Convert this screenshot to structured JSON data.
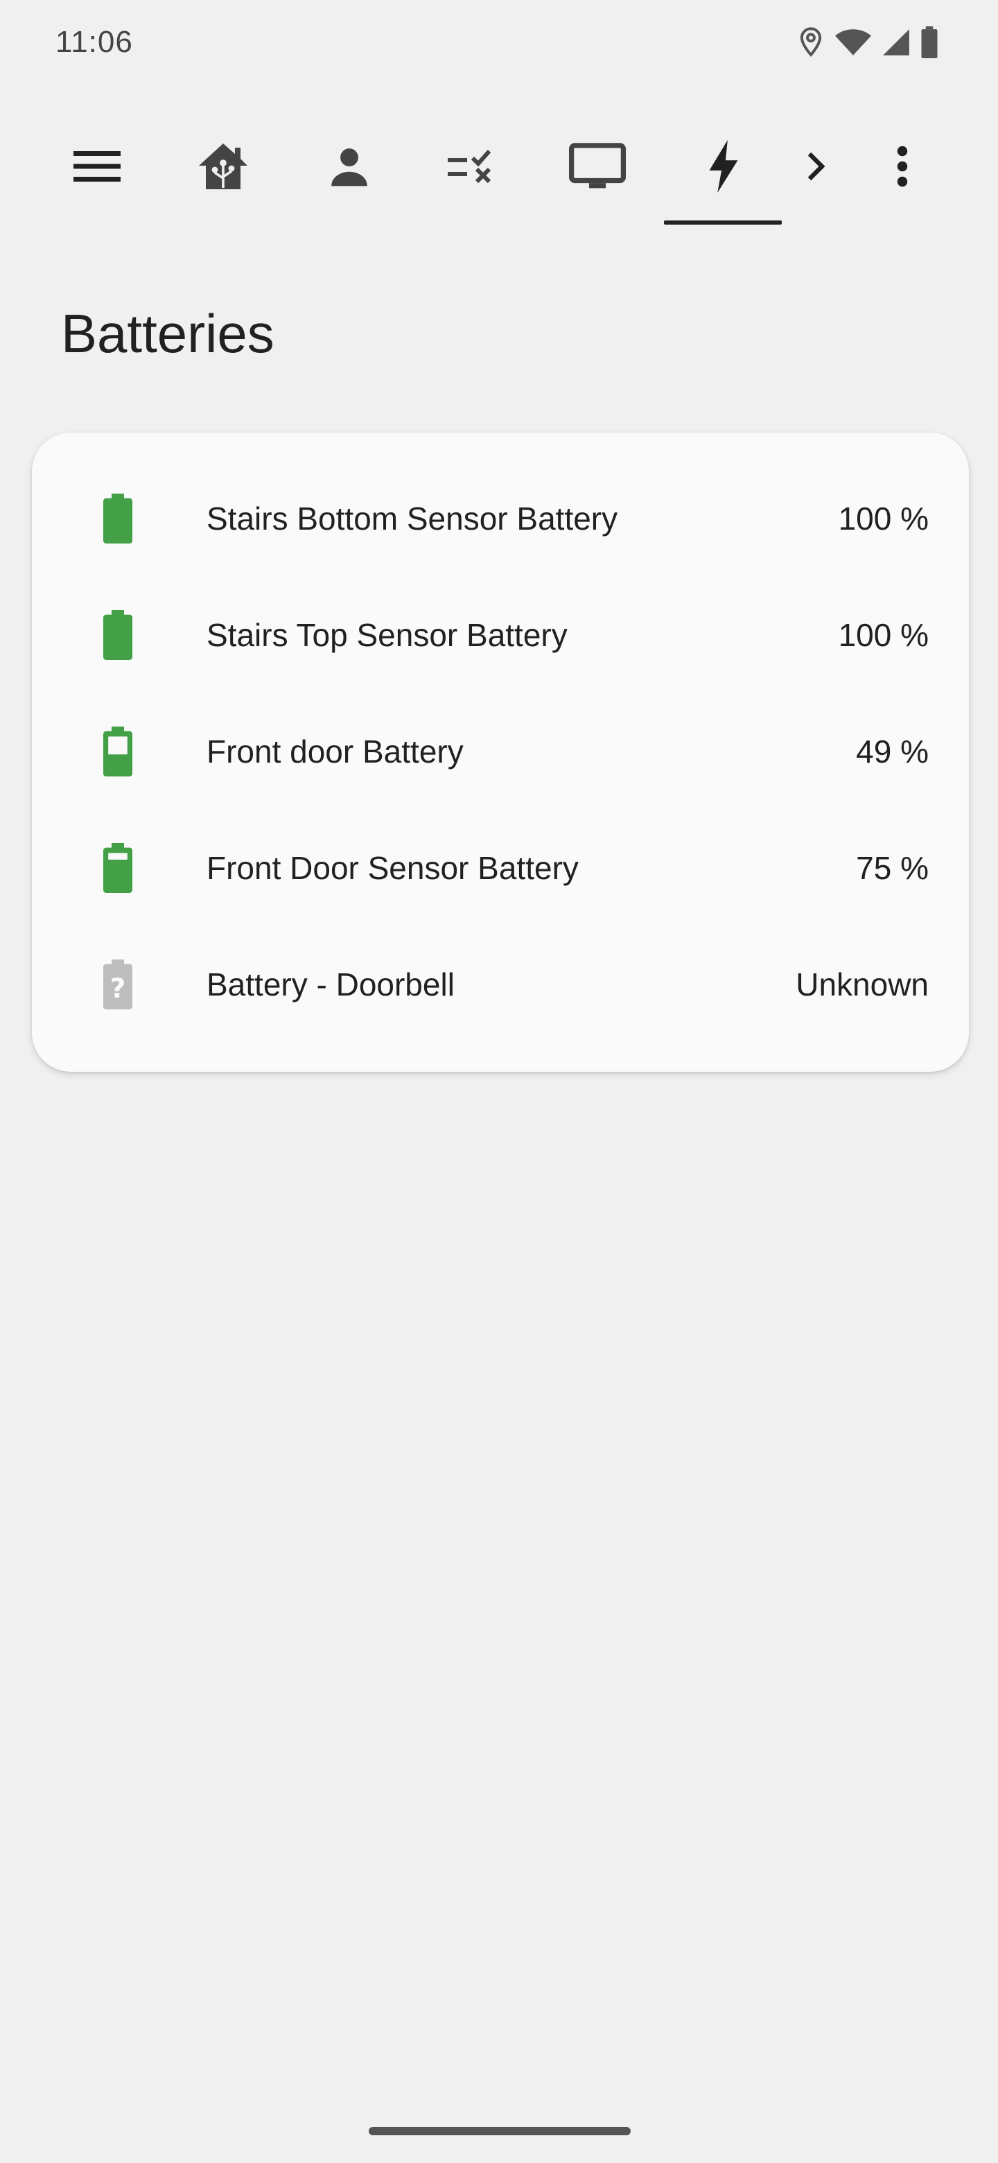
{
  "status_bar": {
    "time": "11:06",
    "icons": [
      "location-icon",
      "wifi-icon",
      "cellular-signal-icon",
      "battery-icon"
    ]
  },
  "toolbar": {
    "items": [
      {
        "name": "menu-icon"
      },
      {
        "name": "home-assistant-icon"
      },
      {
        "name": "person-icon"
      },
      {
        "name": "checklist-icon"
      },
      {
        "name": "monitor-icon"
      },
      {
        "name": "lightning-icon",
        "active": true
      },
      {
        "name": "chevron-right-icon"
      },
      {
        "name": "more-vert-icon"
      }
    ]
  },
  "page": {
    "title": "Batteries"
  },
  "batteries": [
    {
      "label": "Stairs Bottom Sensor Battery",
      "value": "100 %",
      "level": 100,
      "icon": "battery-full-icon"
    },
    {
      "label": "Stairs Top Sensor Battery",
      "value": "100 %",
      "level": 100,
      "icon": "battery-full-icon"
    },
    {
      "label": "Front door Battery",
      "value": "49 %",
      "level": 49,
      "icon": "battery-50-icon"
    },
    {
      "label": "Front Door Sensor Battery",
      "value": "75 %",
      "level": 75,
      "icon": "battery-80-icon"
    },
    {
      "label": "Battery - Doorbell",
      "value": "Unknown",
      "level": null,
      "icon": "battery-unknown-icon"
    }
  ],
  "colors": {
    "battery_ok": "#43a047",
    "battery_unknown": "#bdbdbd",
    "background": "#f0f0f0",
    "card": "#fafafa"
  }
}
